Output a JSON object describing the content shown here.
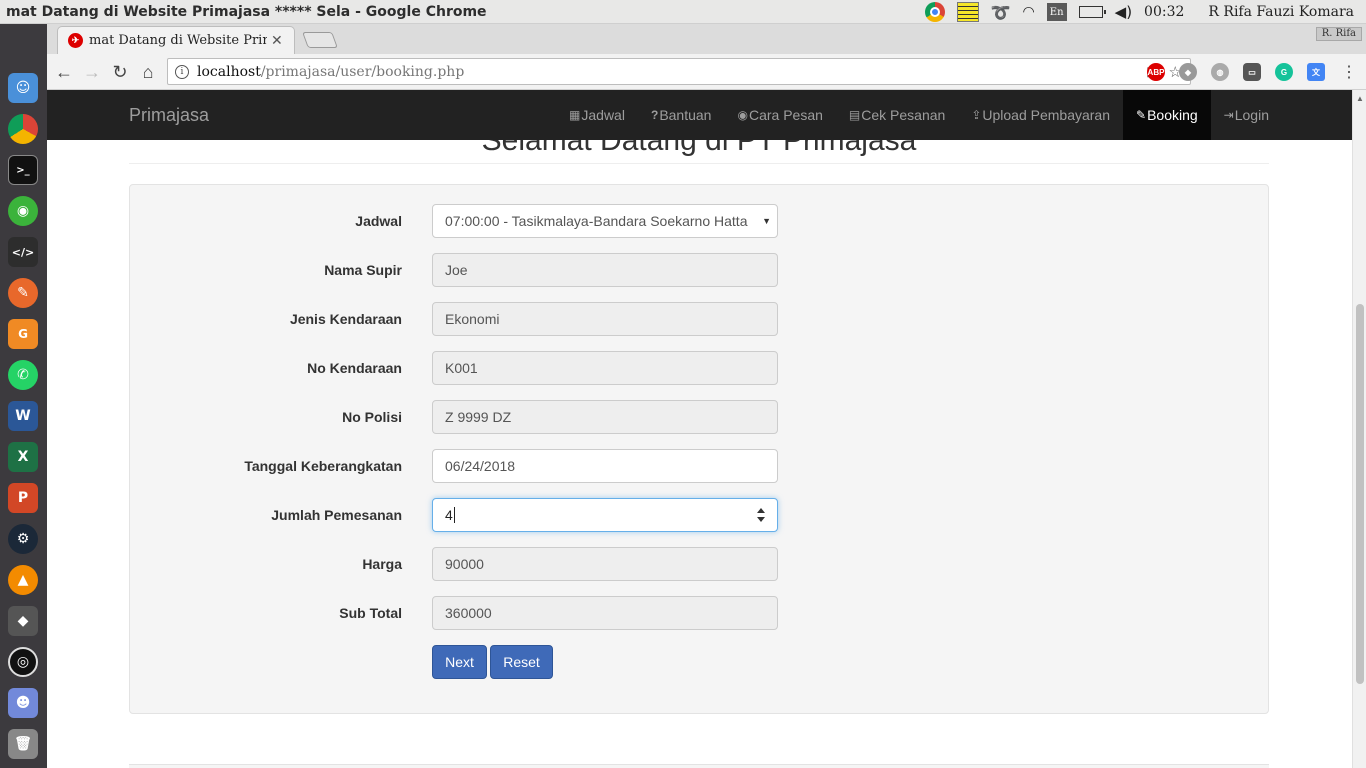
{
  "os": {
    "window_title": "mat Datang di Website Primajasa ***** Sela - Google Chrome",
    "lang": "En",
    "clock": "00:32",
    "user": "R Rifa Fauzi Komara"
  },
  "browser": {
    "tab_title": "mat Datang di Website Primajasa",
    "url_host": "localhost",
    "url_path": "/primajasa/user/booking.php",
    "profile": "R. Rifa",
    "abp_label": "ABP"
  },
  "navbar": {
    "brand": "Primajasa",
    "items": [
      {
        "icon": "calendar-icon",
        "glyph": "▦",
        "label": "Jadwal"
      },
      {
        "icon": "question-icon",
        "glyph": "?",
        "label": "Bantuan"
      },
      {
        "icon": "eye-icon",
        "glyph": "◉",
        "label": "Cara Pesan"
      },
      {
        "icon": "table-icon",
        "glyph": "▤",
        "label": "Cek Pesanan"
      },
      {
        "icon": "upload-icon",
        "glyph": "⇪",
        "label": "Upload Pembayaran"
      },
      {
        "icon": "edit-icon",
        "glyph": "✎",
        "label": "Booking",
        "active": true
      },
      {
        "icon": "login-icon",
        "glyph": "⇥",
        "label": "Login"
      }
    ]
  },
  "heading": "Selamat Datang di PT Primajasa",
  "form": {
    "jadwal_label": "Jadwal",
    "jadwal_value": "07:00:00 - Tasikmalaya-Bandara Soekarno Hatta",
    "supir_label": "Nama Supir",
    "supir_value": "Joe",
    "jenis_label": "Jenis Kendaraan",
    "jenis_value": "Ekonomi",
    "nokend_label": "No Kendaraan",
    "nokend_value": "K001",
    "polisi_label": "No Polisi",
    "polisi_value": "Z 9999 DZ",
    "tanggal_label": "Tanggal Keberangkatan",
    "tanggal_value": "06/24/2018",
    "jumlah_label": "Jumlah Pemesanan",
    "jumlah_value": "4",
    "harga_label": "Harga",
    "harga_value": "90000",
    "subtotal_label": "Sub Total",
    "subtotal_value": "360000",
    "next_label": "Next",
    "reset_label": "Reset"
  }
}
